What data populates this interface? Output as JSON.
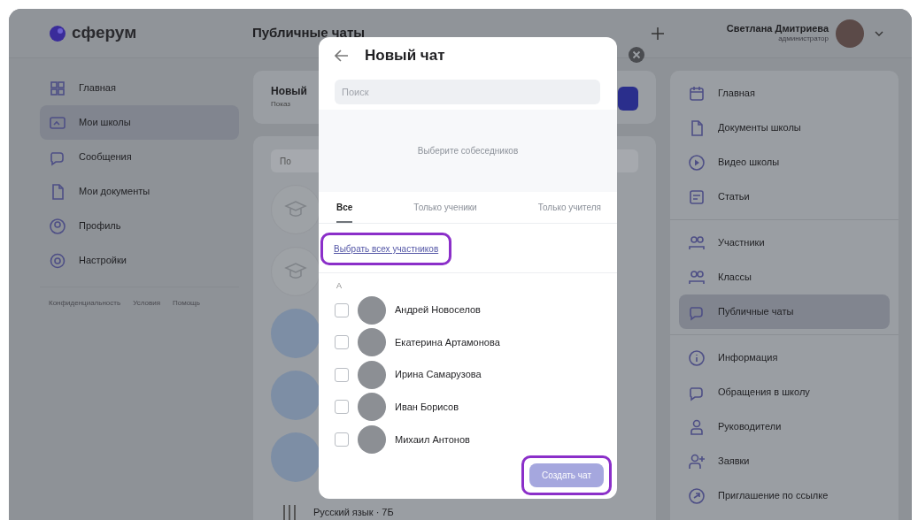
{
  "header": {
    "logo": "сферум",
    "page_title": "Публичные чаты",
    "user": {
      "name": "Светлана Дмитриева",
      "role": "администратор"
    }
  },
  "left_nav": {
    "items": [
      {
        "kind": "grid",
        "label": "Главная",
        "selected": false
      },
      {
        "kind": "school",
        "label": "Мои школы",
        "selected": true
      },
      {
        "kind": "chat",
        "label": "Сообщения",
        "selected": false
      },
      {
        "kind": "document",
        "label": "Мои документы",
        "selected": false
      },
      {
        "kind": "profile",
        "label": "Профиль",
        "selected": false
      },
      {
        "kind": "gear",
        "label": "Настройки",
        "selected": false
      }
    ],
    "footer_links": [
      "Конфиденциальность",
      "Условия",
      "Помощь"
    ]
  },
  "chats_panel": {
    "header_title": "Новый",
    "header_subtitle": "Показ",
    "search_placeholder": "По",
    "avatars": [
      {
        "kind": "cap"
      },
      {
        "kind": "cap"
      },
      {
        "kind": "photo"
      },
      {
        "kind": "photo"
      },
      {
        "kind": "photo"
      }
    ],
    "last_item_label": "Русский язык · 7Б"
  },
  "right_nav": {
    "groups": [
      [
        {
          "kind": "calendar",
          "label": "Главная",
          "selected": false
        },
        {
          "kind": "document",
          "label": "Документы школы",
          "selected": false
        },
        {
          "kind": "play",
          "label": "Видео школы",
          "selected": false
        },
        {
          "kind": "article",
          "label": "Статьи",
          "selected": false
        }
      ],
      [
        {
          "kind": "people",
          "label": "Участники",
          "selected": false
        },
        {
          "kind": "people",
          "label": "Классы",
          "selected": false
        },
        {
          "kind": "chat",
          "label": "Публичные чаты",
          "selected": true
        }
      ],
      [
        {
          "kind": "info",
          "label": "Информация",
          "selected": false
        },
        {
          "kind": "chat",
          "label": "Обращения в школу",
          "selected": false
        },
        {
          "kind": "person",
          "label": "Руководители",
          "selected": false
        },
        {
          "kind": "person-add",
          "label": "Заявки",
          "selected": false
        },
        {
          "kind": "link",
          "label": "Приглашение по ссылке",
          "selected": false
        }
      ]
    ]
  },
  "modal": {
    "title": "Новый чат",
    "search_placeholder": "Поиск",
    "empty_hint": "Выберите собеседников",
    "tabs": [
      {
        "label": "Все",
        "selected": true
      },
      {
        "label": "Только ученики",
        "selected": false
      },
      {
        "label": "Только учителя",
        "selected": false
      }
    ],
    "select_all": {
      "label": "Выбрать всех участников",
      "highlighted": true
    },
    "section_letter": "А",
    "contacts": [
      {
        "name": "Андрей Новоселов",
        "checked": false
      },
      {
        "name": "Екатерина Артамонова",
        "checked": false
      },
      {
        "name": "Ирина Самарузова",
        "checked": false
      },
      {
        "name": "Иван Борисов",
        "checked": false
      },
      {
        "name": "Михаил Антонов",
        "checked": false
      }
    ],
    "create_button": {
      "label": "Создать чат",
      "disabled": true,
      "highlighted": true
    }
  }
}
